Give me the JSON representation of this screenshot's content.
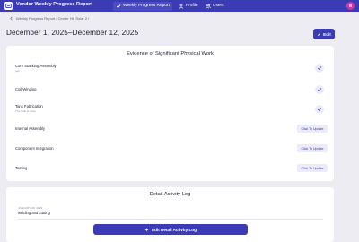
{
  "nav": {
    "app_title": "Vendor Weekly Progress Report",
    "tabs": [
      {
        "label": "Weekly Progress Report",
        "icon": "check-icon"
      },
      {
        "label": "Profile",
        "icon": "profile-icon"
      },
      {
        "label": "Users",
        "icon": "users-icon"
      }
    ],
    "avatar_initial": "B",
    "accent_color": "#3b3bb4",
    "avatar_color": "#c83aa0"
  },
  "breadcrumb": {
    "text": "Weekly Progress Report / Center Hill Solar 2 /"
  },
  "header": {
    "title": "December 1, 2025–December 12, 2025",
    "edit_label": "Edit"
  },
  "evidence": {
    "title": "Evidence of Significant Physical Work",
    "items": [
      {
        "label": "Core Stacking/Assembly",
        "sub": "yes",
        "status": "done"
      },
      {
        "label": "Coil Winding",
        "sub": "",
        "status": "done"
      },
      {
        "label": "Tank Fabrication",
        "sub": "The tank is done",
        "status": "done"
      },
      {
        "label": "Internal Assembly",
        "sub": "",
        "status": "pending",
        "action_label": "Click To Update"
      },
      {
        "label": "Component Integration",
        "sub": "",
        "status": "pending",
        "action_label": "Click To Update"
      },
      {
        "label": "Testing",
        "sub": "",
        "status": "pending",
        "action_label": "Click To Update"
      }
    ]
  },
  "activity_log": {
    "title": "Detail Activity Log",
    "entries": [
      {
        "date": "JANUARY 30, 2026",
        "text": "welding and cutting"
      }
    ],
    "edit_label": "Edit Detail Activity Log"
  }
}
